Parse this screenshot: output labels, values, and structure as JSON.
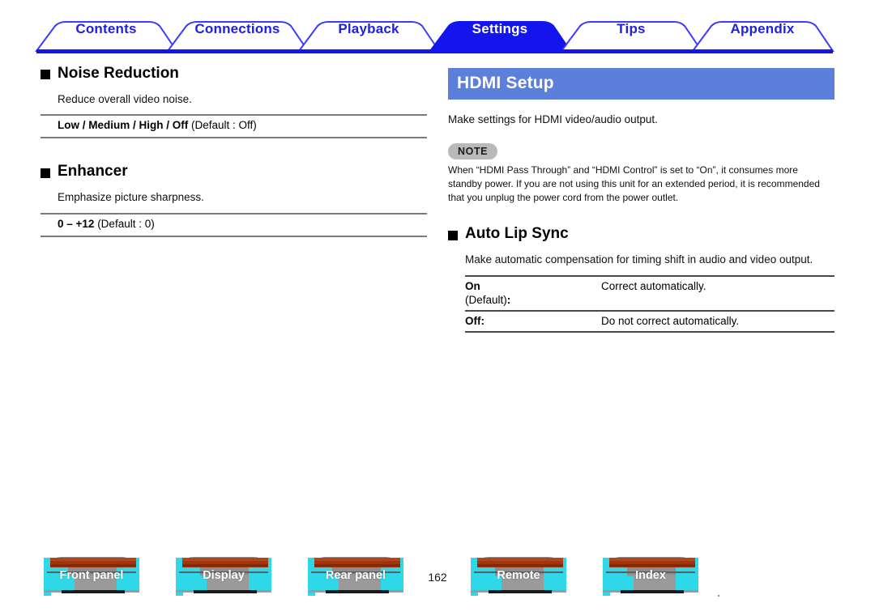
{
  "tabs": [
    {
      "label": "Contents",
      "active": false
    },
    {
      "label": "Connections",
      "active": false
    },
    {
      "label": "Playback",
      "active": false
    },
    {
      "label": "Settings",
      "active": true
    },
    {
      "label": "Tips",
      "active": false
    },
    {
      "label": "Appendix",
      "active": false
    }
  ],
  "left_column": {
    "sections": [
      {
        "heading": "Noise Reduction",
        "description": "Reduce overall video noise.",
        "spec_bold": "Low / Medium / High / Off",
        "spec_plain": "(Default : Off)"
      },
      {
        "heading": "Enhancer",
        "description": "Emphasize picture sharpness.",
        "spec_bold": "0 – +12",
        "spec_plain": "(Default : 0)"
      }
    ]
  },
  "right_column": {
    "banner": "HDMI Setup",
    "intro": "Make settings for HDMI video/audio output.",
    "note": {
      "badge": "NOTE",
      "text": "When “HDMI Pass Through” and “HDMI Control” is set to “On”, it consumes more standby power. If you are not using this unit for an extended period, it is recommended that you unplug the power cord from the power outlet."
    },
    "section": {
      "heading": "Auto Lip Sync",
      "description": "Make automatic compensation for timing shift in audio and video output.",
      "table": {
        "rows": [
          {
            "key_main": "On",
            "key_sub": "(Default)",
            "key_sub_colon": ":",
            "value": "Correct automatically."
          },
          {
            "key_main": "Off:",
            "key_sub": "",
            "key_sub_colon": "",
            "value": "Do not correct automatically."
          }
        ]
      }
    }
  },
  "footer": {
    "buttons": [
      {
        "label": "Front panel"
      },
      {
        "label": "Display"
      },
      {
        "label": "Rear panel"
      },
      {
        "label": "Remote"
      },
      {
        "label": "Index"
      }
    ],
    "page_number": "162"
  },
  "colors": {
    "tab_blue": "#2020e0",
    "banner_blue": "#5b7fdb",
    "note_gray": "#b9b9b9",
    "rule_gray": "#7b7b7b",
    "btn_cyan": "#2fd8e8",
    "btn_wood": "#9e3610",
    "btn_gray": "#8d8d8d"
  }
}
